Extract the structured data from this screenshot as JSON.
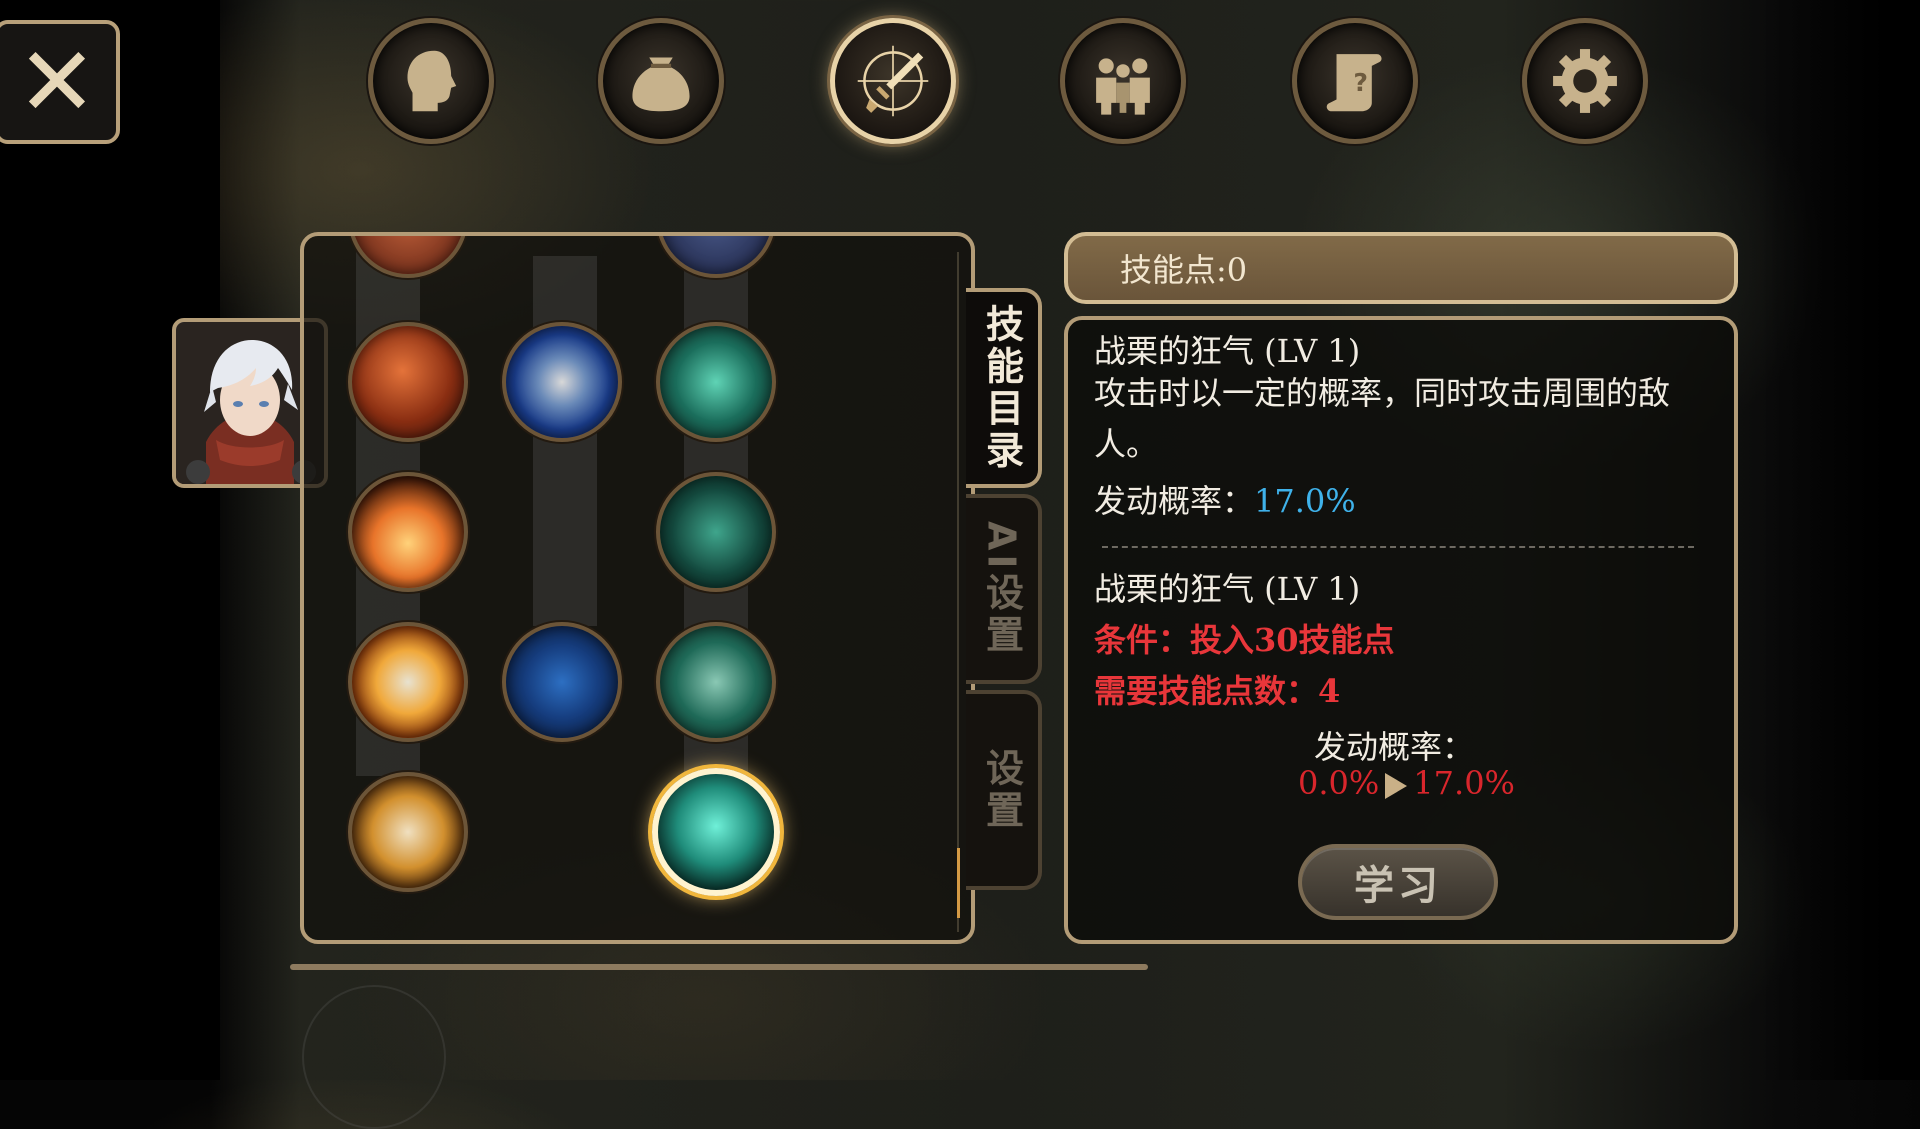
{
  "nav": {
    "items": [
      {
        "name": "character",
        "icon": "head-icon"
      },
      {
        "name": "inventory",
        "icon": "bag-icon"
      },
      {
        "name": "skills",
        "icon": "sword-compass-icon",
        "active": true
      },
      {
        "name": "party",
        "icon": "party-icon"
      },
      {
        "name": "quests",
        "icon": "quest-scroll-icon"
      },
      {
        "name": "settings",
        "icon": "gear-icon"
      }
    ]
  },
  "close": {
    "label": "✕"
  },
  "side_tabs": [
    {
      "label": "技能目录",
      "active": true
    },
    {
      "label": "AI设置",
      "active": false
    },
    {
      "label": "设置",
      "active": false
    }
  ],
  "skill_points": {
    "label": "技能点:",
    "value": "0",
    "text": "技能点:0"
  },
  "skill_info": {
    "current_name": "战栗的狂气 (LV 1)",
    "description": "攻击时以一定的概率，同时攻击周围的敌人。",
    "rate_label": "发动概率：",
    "rate_value": "17.0%",
    "next_name": "战栗的狂气 (LV 1)",
    "condition": "条件：投入30技能点",
    "required_points": "需要技能点数：4",
    "next_rate_label": "发动概率：",
    "from_rate": "0.0%",
    "to_rate": "17.0%"
  },
  "learn_button": {
    "label": "学习"
  },
  "colors": {
    "accent_border": "#b39c77",
    "highlight_blue": "#3fb2ea",
    "warning_red": "#e8363a"
  }
}
